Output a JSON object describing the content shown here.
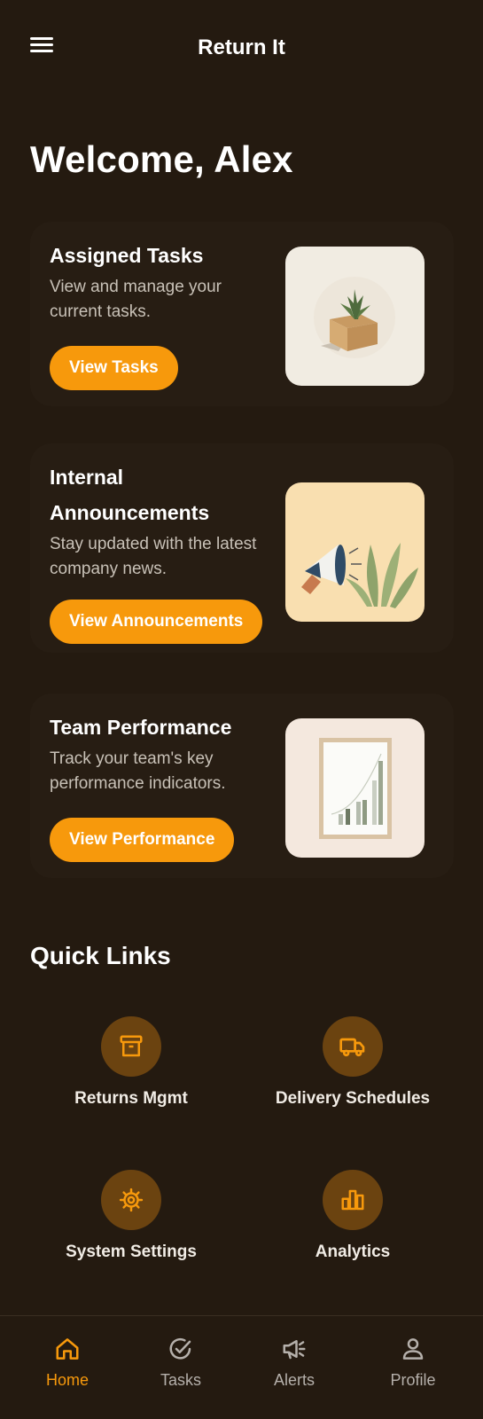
{
  "header": {
    "title": "Return It"
  },
  "welcome": "Welcome, Alex",
  "cards": [
    {
      "title": "Assigned Tasks",
      "description": "View and manage your current tasks.",
      "button": "View Tasks"
    },
    {
      "title": "Internal Announcements",
      "description": "Stay updated with the latest company news.",
      "button": "View Announcements"
    },
    {
      "title": "Team Performance",
      "description": "Track your team's key performance indicators.",
      "button": "View Performance"
    }
  ],
  "quick_links": {
    "title": "Quick Links",
    "items": [
      {
        "label": "Returns Mgmt",
        "icon": "archive-box-icon"
      },
      {
        "label": "Delivery Schedules",
        "icon": "truck-icon"
      },
      {
        "label": "System Settings",
        "icon": "gear-icon"
      },
      {
        "label": "Analytics",
        "icon": "bar-chart-icon"
      }
    ]
  },
  "nav": {
    "items": [
      {
        "label": "Home",
        "icon": "home-icon",
        "active": true
      },
      {
        "label": "Tasks",
        "icon": "check-circle-icon"
      },
      {
        "label": "Alerts",
        "icon": "megaphone-icon"
      },
      {
        "label": "Profile",
        "icon": "person-icon"
      }
    ]
  },
  "colors": {
    "background": "#241a10",
    "accent": "#f7990c",
    "icon_circle": "#6b4310"
  }
}
